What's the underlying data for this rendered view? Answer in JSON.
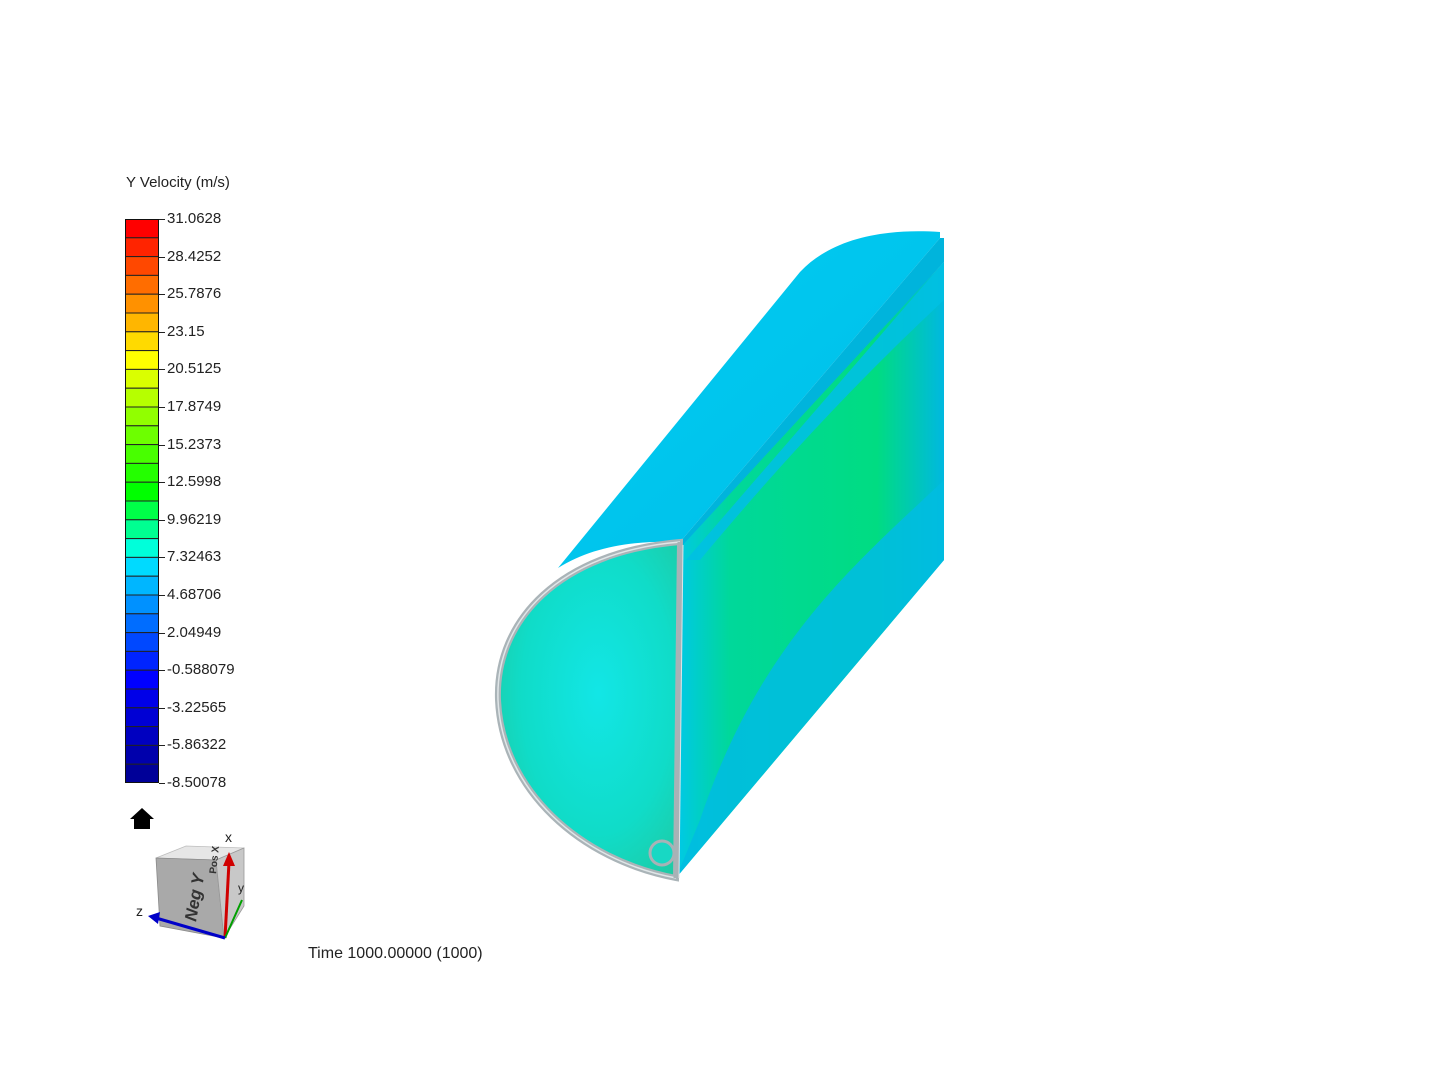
{
  "legend": {
    "title": "Y Velocity (m/s)",
    "ticks": [
      "31.0628",
      "28.4252",
      "25.7876",
      "23.15",
      "20.5125",
      "17.8749",
      "15.2373",
      "12.5998",
      "9.96219",
      "7.32463",
      "4.68706",
      "2.04949",
      "-0.588079",
      "-3.22565",
      "-5.86322",
      "-8.50078"
    ],
    "band_colors": [
      "#ff0000",
      "#ff2400",
      "#ff4800",
      "#ff6d00",
      "#ff9100",
      "#ffb600",
      "#ffda00",
      "#ffff00",
      "#daff00",
      "#b6ff00",
      "#91ff00",
      "#6dff00",
      "#48ff00",
      "#24ff00",
      "#00ff00",
      "#00ff48",
      "#00ff91",
      "#00ffda",
      "#00daff",
      "#00b6ff",
      "#0091ff",
      "#006dff",
      "#0048ff",
      "#0024ff",
      "#0000ff",
      "#0000e8",
      "#0000d4",
      "#0000c0",
      "#0000ac",
      "#000098"
    ]
  },
  "orientation": {
    "front_face": "Neg Y",
    "side_face": "Pos X",
    "axis_x": "x",
    "axis_y": "y",
    "axis_z": "z"
  },
  "home_icon": "home-icon",
  "time": "Time 1000.00000 (1000)",
  "model_colors": {
    "outer_shell": "#00c8f0",
    "flat_face_edge": "#00b4e0",
    "flat_face_core": "#00dc82",
    "cut_face": "#10e0d8",
    "shell_rim": "#b8c4c8"
  }
}
